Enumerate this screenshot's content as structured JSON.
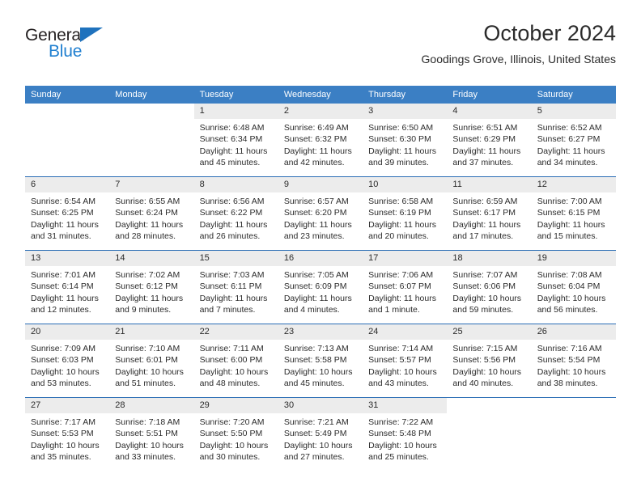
{
  "brand": {
    "name_top": "General",
    "name_bottom": "Blue",
    "triangle_color": "#1f72bd",
    "blue_text_color": "#1f7fd0"
  },
  "header": {
    "title": "October 2024",
    "subtitle": "Goodings Grove, Illinois, United States"
  },
  "theme": {
    "header_bg": "#3b7fc4",
    "row_rule": "#2a6db5",
    "daynum_bg": "#ececec",
    "text": "#2b2b2b"
  },
  "weekdays": [
    "Sunday",
    "Monday",
    "Tuesday",
    "Wednesday",
    "Thursday",
    "Friday",
    "Saturday"
  ],
  "weeks": [
    [
      {
        "day": "",
        "sunrise": "",
        "sunset": "",
        "daylight1": "",
        "daylight2": ""
      },
      {
        "day": "",
        "sunrise": "",
        "sunset": "",
        "daylight1": "",
        "daylight2": ""
      },
      {
        "day": "1",
        "sunrise": "Sunrise: 6:48 AM",
        "sunset": "Sunset: 6:34 PM",
        "daylight1": "Daylight: 11 hours",
        "daylight2": "and 45 minutes."
      },
      {
        "day": "2",
        "sunrise": "Sunrise: 6:49 AM",
        "sunset": "Sunset: 6:32 PM",
        "daylight1": "Daylight: 11 hours",
        "daylight2": "and 42 minutes."
      },
      {
        "day": "3",
        "sunrise": "Sunrise: 6:50 AM",
        "sunset": "Sunset: 6:30 PM",
        "daylight1": "Daylight: 11 hours",
        "daylight2": "and 39 minutes."
      },
      {
        "day": "4",
        "sunrise": "Sunrise: 6:51 AM",
        "sunset": "Sunset: 6:29 PM",
        "daylight1": "Daylight: 11 hours",
        "daylight2": "and 37 minutes."
      },
      {
        "day": "5",
        "sunrise": "Sunrise: 6:52 AM",
        "sunset": "Sunset: 6:27 PM",
        "daylight1": "Daylight: 11 hours",
        "daylight2": "and 34 minutes."
      }
    ],
    [
      {
        "day": "6",
        "sunrise": "Sunrise: 6:54 AM",
        "sunset": "Sunset: 6:25 PM",
        "daylight1": "Daylight: 11 hours",
        "daylight2": "and 31 minutes."
      },
      {
        "day": "7",
        "sunrise": "Sunrise: 6:55 AM",
        "sunset": "Sunset: 6:24 PM",
        "daylight1": "Daylight: 11 hours",
        "daylight2": "and 28 minutes."
      },
      {
        "day": "8",
        "sunrise": "Sunrise: 6:56 AM",
        "sunset": "Sunset: 6:22 PM",
        "daylight1": "Daylight: 11 hours",
        "daylight2": "and 26 minutes."
      },
      {
        "day": "9",
        "sunrise": "Sunrise: 6:57 AM",
        "sunset": "Sunset: 6:20 PM",
        "daylight1": "Daylight: 11 hours",
        "daylight2": "and 23 minutes."
      },
      {
        "day": "10",
        "sunrise": "Sunrise: 6:58 AM",
        "sunset": "Sunset: 6:19 PM",
        "daylight1": "Daylight: 11 hours",
        "daylight2": "and 20 minutes."
      },
      {
        "day": "11",
        "sunrise": "Sunrise: 6:59 AM",
        "sunset": "Sunset: 6:17 PM",
        "daylight1": "Daylight: 11 hours",
        "daylight2": "and 17 minutes."
      },
      {
        "day": "12",
        "sunrise": "Sunrise: 7:00 AM",
        "sunset": "Sunset: 6:15 PM",
        "daylight1": "Daylight: 11 hours",
        "daylight2": "and 15 minutes."
      }
    ],
    [
      {
        "day": "13",
        "sunrise": "Sunrise: 7:01 AM",
        "sunset": "Sunset: 6:14 PM",
        "daylight1": "Daylight: 11 hours",
        "daylight2": "and 12 minutes."
      },
      {
        "day": "14",
        "sunrise": "Sunrise: 7:02 AM",
        "sunset": "Sunset: 6:12 PM",
        "daylight1": "Daylight: 11 hours",
        "daylight2": "and 9 minutes."
      },
      {
        "day": "15",
        "sunrise": "Sunrise: 7:03 AM",
        "sunset": "Sunset: 6:11 PM",
        "daylight1": "Daylight: 11 hours",
        "daylight2": "and 7 minutes."
      },
      {
        "day": "16",
        "sunrise": "Sunrise: 7:05 AM",
        "sunset": "Sunset: 6:09 PM",
        "daylight1": "Daylight: 11 hours",
        "daylight2": "and 4 minutes."
      },
      {
        "day": "17",
        "sunrise": "Sunrise: 7:06 AM",
        "sunset": "Sunset: 6:07 PM",
        "daylight1": "Daylight: 11 hours",
        "daylight2": "and 1 minute."
      },
      {
        "day": "18",
        "sunrise": "Sunrise: 7:07 AM",
        "sunset": "Sunset: 6:06 PM",
        "daylight1": "Daylight: 10 hours",
        "daylight2": "and 59 minutes."
      },
      {
        "day": "19",
        "sunrise": "Sunrise: 7:08 AM",
        "sunset": "Sunset: 6:04 PM",
        "daylight1": "Daylight: 10 hours",
        "daylight2": "and 56 minutes."
      }
    ],
    [
      {
        "day": "20",
        "sunrise": "Sunrise: 7:09 AM",
        "sunset": "Sunset: 6:03 PM",
        "daylight1": "Daylight: 10 hours",
        "daylight2": "and 53 minutes."
      },
      {
        "day": "21",
        "sunrise": "Sunrise: 7:10 AM",
        "sunset": "Sunset: 6:01 PM",
        "daylight1": "Daylight: 10 hours",
        "daylight2": "and 51 minutes."
      },
      {
        "day": "22",
        "sunrise": "Sunrise: 7:11 AM",
        "sunset": "Sunset: 6:00 PM",
        "daylight1": "Daylight: 10 hours",
        "daylight2": "and 48 minutes."
      },
      {
        "day": "23",
        "sunrise": "Sunrise: 7:13 AM",
        "sunset": "Sunset: 5:58 PM",
        "daylight1": "Daylight: 10 hours",
        "daylight2": "and 45 minutes."
      },
      {
        "day": "24",
        "sunrise": "Sunrise: 7:14 AM",
        "sunset": "Sunset: 5:57 PM",
        "daylight1": "Daylight: 10 hours",
        "daylight2": "and 43 minutes."
      },
      {
        "day": "25",
        "sunrise": "Sunrise: 7:15 AM",
        "sunset": "Sunset: 5:56 PM",
        "daylight1": "Daylight: 10 hours",
        "daylight2": "and 40 minutes."
      },
      {
        "day": "26",
        "sunrise": "Sunrise: 7:16 AM",
        "sunset": "Sunset: 5:54 PM",
        "daylight1": "Daylight: 10 hours",
        "daylight2": "and 38 minutes."
      }
    ],
    [
      {
        "day": "27",
        "sunrise": "Sunrise: 7:17 AM",
        "sunset": "Sunset: 5:53 PM",
        "daylight1": "Daylight: 10 hours",
        "daylight2": "and 35 minutes."
      },
      {
        "day": "28",
        "sunrise": "Sunrise: 7:18 AM",
        "sunset": "Sunset: 5:51 PM",
        "daylight1": "Daylight: 10 hours",
        "daylight2": "and 33 minutes."
      },
      {
        "day": "29",
        "sunrise": "Sunrise: 7:20 AM",
        "sunset": "Sunset: 5:50 PM",
        "daylight1": "Daylight: 10 hours",
        "daylight2": "and 30 minutes."
      },
      {
        "day": "30",
        "sunrise": "Sunrise: 7:21 AM",
        "sunset": "Sunset: 5:49 PM",
        "daylight1": "Daylight: 10 hours",
        "daylight2": "and 27 minutes."
      },
      {
        "day": "31",
        "sunrise": "Sunrise: 7:22 AM",
        "sunset": "Sunset: 5:48 PM",
        "daylight1": "Daylight: 10 hours",
        "daylight2": "and 25 minutes."
      },
      {
        "day": "",
        "sunrise": "",
        "sunset": "",
        "daylight1": "",
        "daylight2": ""
      },
      {
        "day": "",
        "sunrise": "",
        "sunset": "",
        "daylight1": "",
        "daylight2": ""
      }
    ]
  ]
}
